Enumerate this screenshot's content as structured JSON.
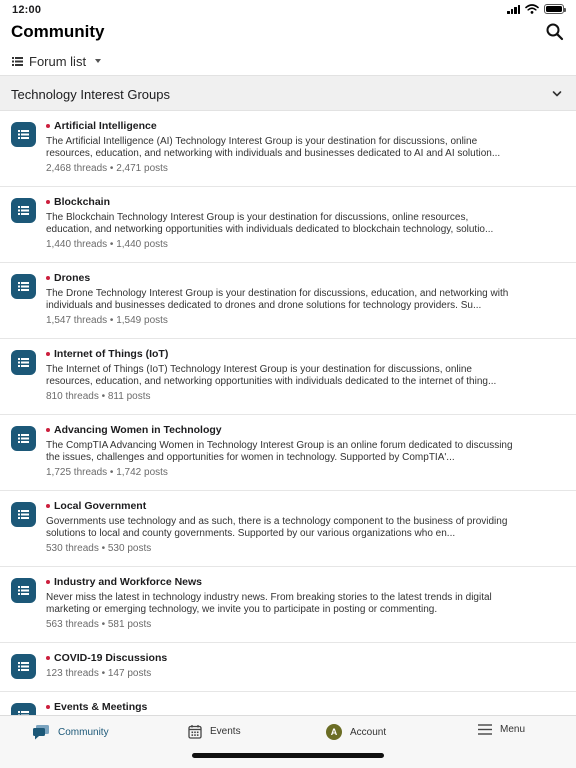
{
  "status_bar": {
    "time": "12:00",
    "signal_icon": "signal-icon",
    "wifi_icon": "wifi-icon",
    "battery_icon": "battery-icon"
  },
  "header": {
    "title": "Community",
    "search_icon": "search-icon"
  },
  "forum_select": {
    "icon": "list-icon",
    "label": "Forum list"
  },
  "section": {
    "title": "Technology Interest Groups",
    "chevron_icon": "chevron-down-icon"
  },
  "forums": [
    {
      "title": "Artificial Intelligence",
      "description": "The Artificial Intelligence (AI) Technology Interest Group is your destination for discussions, online resources, education, and networking with individuals and businesses dedicated to AI and AI solution...",
      "stats": "2,468 threads • 2,471 posts"
    },
    {
      "title": "Blockchain",
      "description": "The Blockchain Technology Interest Group is your destination for discussions, online resources, education, and networking opportunities with individuals dedicated to blockchain technology, solutio...",
      "stats": "1,440 threads • 1,440 posts"
    },
    {
      "title": "Drones",
      "description": "The Drone Technology Interest Group is your destination for discussions, education, and networking with individuals and businesses dedicated to drones and drone solutions for technology providers. Su...",
      "stats": "1,547 threads • 1,549 posts"
    },
    {
      "title": "Internet of Things (IoT)",
      "description": "The Internet of Things (IoT) Technology Interest Group is your destination for discussions, online resources, education, and networking opportunities with individuals dedicated to the internet of thing...",
      "stats": "810 threads • 811 posts"
    },
    {
      "title": "Advancing Women in Technology",
      "description": "The CompTIA Advancing Women in Technology Interest Group is an online forum dedicated to discussing the issues, challenges and opportunities for women in technology. Supported by CompTIA'...",
      "stats": "1,725 threads • 1,742 posts"
    },
    {
      "title": "Local Government",
      "description": "Governments use technology and as such, there is a technology component to the business of providing solutions to local and county governments. Supported by our various organizations who en...",
      "stats": "530 threads • 530 posts"
    },
    {
      "title": "Industry and Workforce News",
      "description": "Never miss the latest in technology industry news. From breaking stories to the latest trends in digital marketing or emerging technology, we invite you to participate in posting or commenting.",
      "stats": "563 threads • 581 posts"
    },
    {
      "title": "COVID-19 Discussions",
      "description": "",
      "stats": "123 threads • 147 posts"
    },
    {
      "title": "Events & Meetings",
      "description": "",
      "stats": ""
    }
  ],
  "tab_bar": {
    "tabs": [
      {
        "label": "Community",
        "icon": "chat-bubbles-icon",
        "active": true
      },
      {
        "label": "Events",
        "icon": "calendar-icon",
        "active": false
      },
      {
        "label": "Account",
        "icon": "avatar-icon",
        "avatar_letter": "A",
        "active": false
      },
      {
        "label": "Menu",
        "icon": "hamburger-menu-icon",
        "active": false
      }
    ]
  },
  "colors": {
    "accent": "#1c5878",
    "unread_dot": "#cc1f3d",
    "avatar": "#6b6d25",
    "section_bg": "#f0f0f0"
  }
}
